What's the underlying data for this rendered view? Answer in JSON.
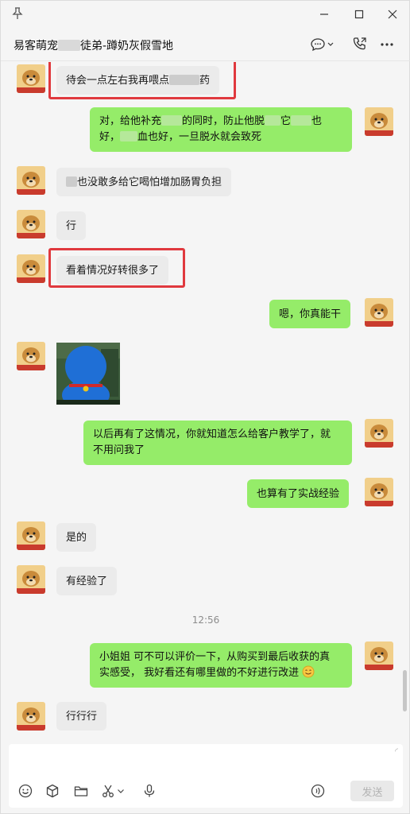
{
  "window": {
    "title_prefix": "易客萌宠",
    "title_suffix": "徒弟-蹲奶灰假雪地"
  },
  "messages": [
    {
      "side": "in",
      "text_a": "待会一点左右我再喂点",
      "text_b": "药",
      "highlighted": true
    },
    {
      "side": "out",
      "line1_a": "对，给他补充",
      "line1_b": "的同时，防止他脱",
      "line1_c": "它",
      "line1_d": "也",
      "line2_a": "好，",
      "line2_b": "血也好，一旦脱水就会致死"
    },
    {
      "side": "in",
      "text": "也没敢多给它喝怕增加肠胃负担"
    },
    {
      "side": "in",
      "text": "行"
    },
    {
      "side": "in",
      "text": "看着情况好转很多了",
      "highlighted": true
    },
    {
      "side": "out",
      "text": "嗯，你真能干"
    },
    {
      "side": "in",
      "type": "sticker",
      "sticker": "doraemon-back-sticker"
    },
    {
      "side": "out",
      "line1": "以后再有了这情况，你就知道怎么给客户教学了，就",
      "line2": "不用问我了"
    },
    {
      "side": "out",
      "text": "也算有了实战经验"
    },
    {
      "side": "in",
      "text": "是的"
    },
    {
      "side": "in",
      "text": "有经验了"
    },
    {
      "side": "out",
      "line1": "小姐姐 可不可以评价一下，从购买到最后收获的真",
      "line2": "实感受， 我好看还有哪里做的不好进行改进"
    },
    {
      "side": "in",
      "text": "行行行"
    }
  ],
  "timestamp": "12:56",
  "composer": {
    "send_label": "发送",
    "tools": [
      "emoji-icon",
      "cube-icon",
      "folder-icon",
      "scissors-icon",
      "chevron-down-icon",
      "microphone-icon",
      "voice-call-icon"
    ]
  },
  "colors": {
    "incoming_bubble": "#ebebeb",
    "outgoing_bubble": "#95ec69",
    "highlight_box": "#e0393e",
    "background": "#f5f5f5"
  }
}
